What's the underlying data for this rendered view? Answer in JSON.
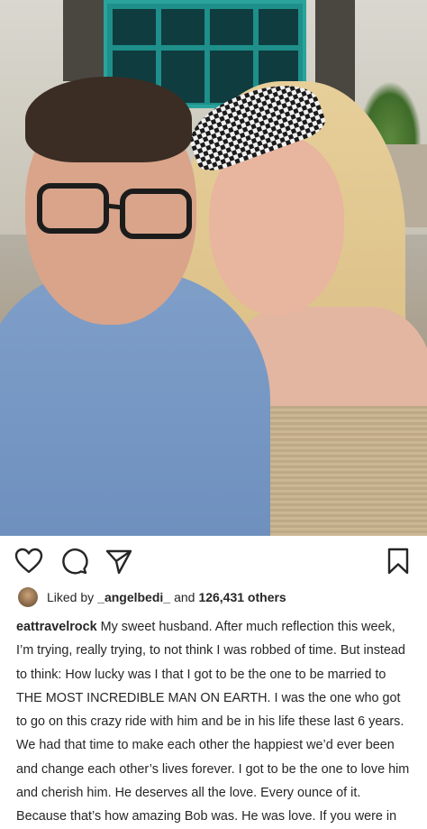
{
  "post": {
    "image_alt": "Selfie of a man with glasses in a blue shirt and a woman with a houndstooth headband",
    "icons": {
      "like": "heart-icon",
      "comment": "comment-bubble-icon",
      "share": "paper-plane-icon",
      "save": "bookmark-icon"
    },
    "likes": {
      "prefix": "Liked by",
      "user": "_angelbedi_",
      "joiner": "and",
      "count": "126,431 others"
    },
    "caption": {
      "username": "eattravelrock",
      "text": "My sweet husband. After much reflection this week, I’m trying, really trying, to not think I was robbed of time. But instead to think: How lucky was I that I got to be the one to be married to THE MOST INCREDIBLE MAN ON EARTH. I was the one who got to go on this crazy ride with him and be in his life these last 6 years. We had that time to make each other the happiest we’d ever been and change each other’s lives forever. I got to be the one to love him and cherish him. He deserves all the love. Every ounce of it. Because that’s how amazing Bob was. He was love. If you were in"
    }
  }
}
